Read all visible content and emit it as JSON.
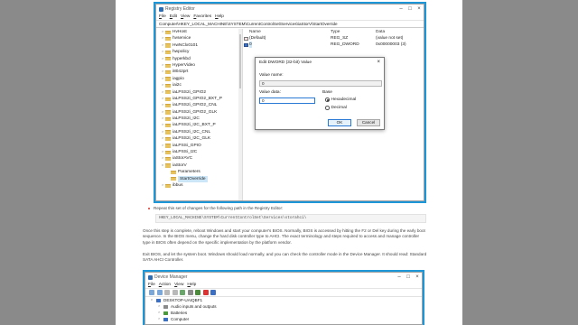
{
  "registry_editor": {
    "title": "Registry Editor",
    "menu": [
      "File",
      "Edit",
      "View",
      "Favorites",
      "Help"
    ],
    "address": "Computer\\HKEY_LOCAL_MACHINE\\SYSTEM\\CurrentControlSet\\Services\\iaStorV\\StartOverride",
    "tree": [
      {
        "label": "HvHost",
        "depth": 0,
        "expander": ">"
      },
      {
        "label": "hvservice",
        "depth": 0,
        "expander": ">"
      },
      {
        "label": "HwNClx0101",
        "depth": 0,
        "expander": ">"
      },
      {
        "label": "hwpolicy",
        "depth": 0,
        "expander": ">"
      },
      {
        "label": "hyperkbd",
        "depth": 0,
        "expander": ">"
      },
      {
        "label": "HyperVideo",
        "depth": 0,
        "expander": ">"
      },
      {
        "label": "i8042prt",
        "depth": 0,
        "expander": ">"
      },
      {
        "label": "iagpio",
        "depth": 0,
        "expander": ">"
      },
      {
        "label": "iai2c",
        "depth": 0,
        "expander": ">"
      },
      {
        "label": "iaLPSS2i_GPIO2",
        "depth": 0,
        "expander": ">"
      },
      {
        "label": "iaLPSS2i_GPIO2_BXT_P",
        "depth": 0,
        "expander": ">"
      },
      {
        "label": "iaLPSS2i_GPIO2_CNL",
        "depth": 0,
        "expander": ">"
      },
      {
        "label": "iaLPSS2i_GPIO2_GLK",
        "depth": 0,
        "expander": ">"
      },
      {
        "label": "iaLPSS2i_I2C",
        "depth": 0,
        "expander": ">"
      },
      {
        "label": "iaLPSS2i_I2C_BXT_P",
        "depth": 0,
        "expander": ">"
      },
      {
        "label": "iaLPSS2i_I2C_CNL",
        "depth": 0,
        "expander": ">"
      },
      {
        "label": "iaLPSS2i_I2C_GLK",
        "depth": 0,
        "expander": ">"
      },
      {
        "label": "iaLPSSi_GPIO",
        "depth": 0,
        "expander": ">"
      },
      {
        "label": "iaLPSSi_I2C",
        "depth": 0,
        "expander": ">"
      },
      {
        "label": "iaStorAVC",
        "depth": 0,
        "expander": ">"
      },
      {
        "label": "iaStorV",
        "depth": 0,
        "expander": "v"
      },
      {
        "label": "Parameters",
        "depth": 1,
        "expander": ""
      },
      {
        "label": "StartOverride",
        "depth": 1,
        "expander": "",
        "selected": true
      },
      {
        "label": "ibbus",
        "depth": 0,
        "expander": ">"
      }
    ],
    "columns": {
      "name": "Name",
      "type": "Type",
      "data": "Data"
    },
    "values": [
      {
        "name": "(Default)",
        "type": "REG_SZ",
        "data": "(value not set)",
        "icon": "string-value-icon"
      },
      {
        "name": "0",
        "type": "REG_DWORD",
        "data": "0x00000003 (3)",
        "icon": "dword-value-icon"
      }
    ]
  },
  "dword_dialog": {
    "title": "Edit DWORD (32-bit) Value",
    "value_name_label": "Value name:",
    "value_name": "0",
    "value_data_label": "Value data:",
    "value_data": "0",
    "base_label": "Base",
    "base_options": [
      "Hexadecimal",
      "Decimal"
    ],
    "base_selected": "Hexadecimal",
    "ok_label": "OK",
    "cancel_label": "Cancel"
  },
  "article": {
    "bullet_text": "Repeat this set of changes for the following path in the Registry Editor:",
    "code_path": "HKEY_LOCAL_MACHINE\\SYSTEM\\CurrentControlSet\\Services\\storahci\\",
    "paragraph1": "Once this step is complete, reboot Windows and start your computer's BIOS. Normally, BIOS is accessed by hitting the F2 or Del key during the early boot sequence. In the BIOS menu, change the hard disk controller type to AHCI. The exact terminology and steps required to access and manage controller type in BIOS often depend on the specific implementation by the platform vendor.",
    "paragraph2": "Exit BIOS, and let the system boot. Windows should load normally, and you can check the controller mode in the Device Manager. It should read: Standard SATA AHCI Controller."
  },
  "device_manager": {
    "title": "Device Manager",
    "menu": [
      "File",
      "Action",
      "View",
      "Help"
    ],
    "nodes": [
      {
        "label": "DESKTOP-UAIQBF1",
        "expander": "v",
        "indent": 0,
        "color": "#3a6fc4"
      },
      {
        "label": "Audio inputs and outputs",
        "expander": ">",
        "indent": 1,
        "color": "#8a8a8a"
      },
      {
        "label": "Batteries",
        "expander": ">",
        "indent": 1,
        "color": "#4a9a3a"
      },
      {
        "label": "Computer",
        "expander": ">",
        "indent": 1,
        "color": "#3a6fc4"
      }
    ]
  },
  "colors": {
    "frame_border": "#1d97d8",
    "bullet": "#d9352b",
    "selection": "#cce6f7",
    "folder": "#e8c25a"
  }
}
